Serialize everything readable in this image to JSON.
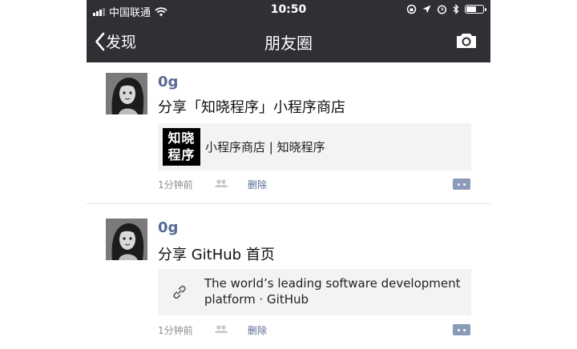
{
  "status_bar": {
    "carrier": "中国联通",
    "time": "10:50",
    "icons": [
      "signal-icon",
      "wifi-icon",
      "rotation-lock-icon",
      "location-icon",
      "alarm-icon",
      "bluetooth-icon",
      "battery-icon"
    ]
  },
  "navbar": {
    "back_label": "发现",
    "title": "朋友圈",
    "camera_icon": "camera-icon"
  },
  "posts": [
    {
      "username": "0g",
      "text": "分享「知晓程序」小程序商店",
      "card": {
        "thumb_line1": "知晓",
        "thumb_line2": "程序",
        "title": "小程序商店 | 知晓程序"
      },
      "time": "1分钟前",
      "delete_label": "删除"
    },
    {
      "username": "0g",
      "text": "分享 GitHub 首页",
      "card": {
        "icon": "link-icon",
        "title": "The world’s leading software development platform · GitHub"
      },
      "time": "1分钟前",
      "delete_label": "删除"
    }
  ],
  "colors": {
    "nav_bg": "#2f2f34",
    "username": "#576b95",
    "card_bg": "#f3f3f5"
  }
}
